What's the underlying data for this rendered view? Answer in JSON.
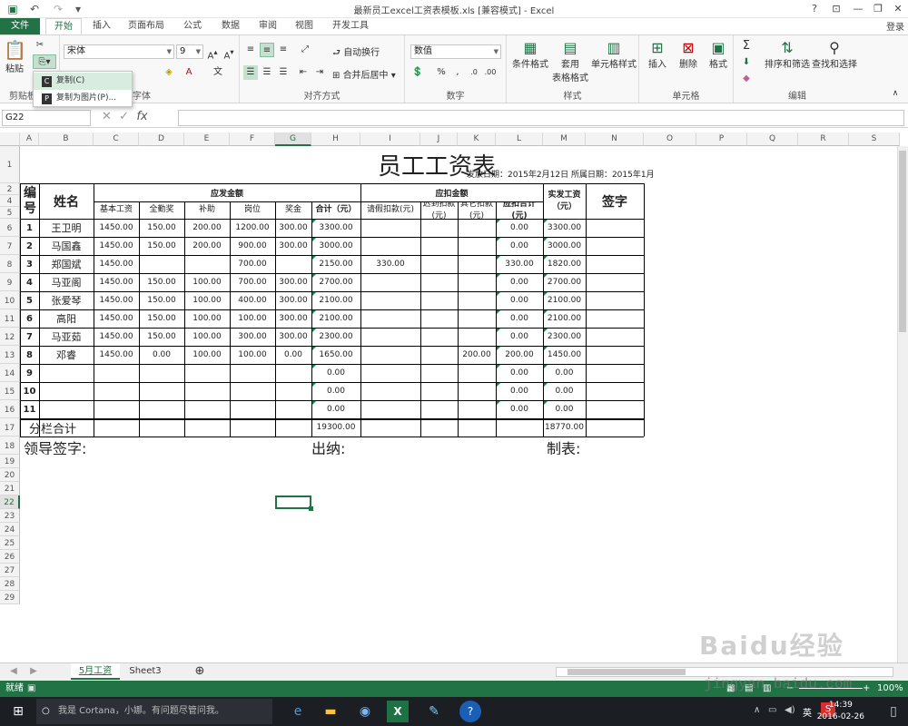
{
  "window": {
    "title": "最新员工excel工资表模板.xls  [兼容模式] - Excel",
    "login": "登录"
  },
  "tabs": [
    "文件",
    "开始",
    "插入",
    "页面布局",
    "公式",
    "数据",
    "审阅",
    "视图",
    "开发工具"
  ],
  "ribbon": {
    "clipboard": {
      "paste": "粘贴",
      "group": "剪贴板"
    },
    "font": {
      "name": "宋体",
      "size": "9",
      "group": "字体"
    },
    "alignment": {
      "wrap": "自动换行",
      "merge": "合并后居中",
      "group": "对齐方式"
    },
    "number": {
      "format": "数值",
      "percent": "%",
      "group": "数字"
    },
    "styles": {
      "cond": "条件格式",
      "table_l1": "套用",
      "table_l2": "表格格式",
      "cell": "单元格样式",
      "group": "样式"
    },
    "cells": {
      "insert": "插入",
      "delete": "删除",
      "format": "格式",
      "group": "单元格"
    },
    "editing": {
      "sort": "排序和筛选",
      "find": "查找和选择",
      "group": "编辑"
    }
  },
  "clip_menu": [
    {
      "key": "C",
      "label": "复制(C)"
    },
    {
      "key": "P",
      "label": "复制为图片(P)..."
    }
  ],
  "namebox": "G22",
  "columns": [
    "A",
    "B",
    "C",
    "D",
    "E",
    "F",
    "G",
    "H",
    "I",
    "J",
    "K",
    "L",
    "M",
    "N",
    "O",
    "P",
    "Q",
    "R",
    "S"
  ],
  "rows": [
    "1",
    "2",
    "4",
    "5",
    "6",
    "7",
    "8",
    "9",
    "10",
    "11",
    "12",
    "13",
    "14",
    "15",
    "16",
    "17",
    "18",
    "19",
    "20",
    "21",
    "22",
    "23",
    "24",
    "25",
    "26",
    "27",
    "28",
    "29"
  ],
  "sheet": {
    "title": "员工工资表",
    "subtitle": "发放日期：2015年2月12日 所属日期：2015年1月",
    "h_no": "编号",
    "h_name": "姓名",
    "h_payable": "应发金额",
    "h_deduct": "应扣金额",
    "h_actual": "实发工资（元）",
    "h_sign": "签字",
    "sub_headers": [
      "基本工资",
      "全勤奖",
      "补助",
      "岗位",
      "奖金",
      "合计（元）",
      "请假扣款(元)",
      "迟到扣款(元)",
      "其它扣款(元)",
      "应扣合计(元)"
    ],
    "data_rows": [
      [
        "1",
        "王卫明",
        "1450.00",
        "150.00",
        "200.00",
        "1200.00",
        "300.00",
        "3300.00",
        "",
        "",
        "",
        "0.00",
        "3300.00"
      ],
      [
        "2",
        "马国鑫",
        "1450.00",
        "150.00",
        "200.00",
        "900.00",
        "300.00",
        "3000.00",
        "",
        "",
        "",
        "0.00",
        "3000.00"
      ],
      [
        "3",
        "郑国斌",
        "1450.00",
        "",
        "",
        "700.00",
        "",
        "2150.00",
        "330.00",
        "",
        "",
        "330.00",
        "1820.00"
      ],
      [
        "4",
        "马亚阁",
        "1450.00",
        "150.00",
        "100.00",
        "700.00",
        "300.00",
        "2700.00",
        "",
        "",
        "",
        "0.00",
        "2700.00"
      ],
      [
        "5",
        "张爱琴",
        "1450.00",
        "150.00",
        "100.00",
        "400.00",
        "300.00",
        "2100.00",
        "",
        "",
        "",
        "0.00",
        "2100.00"
      ],
      [
        "6",
        "高阳",
        "1450.00",
        "150.00",
        "100.00",
        "100.00",
        "300.00",
        "2100.00",
        "",
        "",
        "",
        "0.00",
        "2100.00"
      ],
      [
        "7",
        "马亚茹",
        "1450.00",
        "150.00",
        "100.00",
        "300.00",
        "300.00",
        "2300.00",
        "",
        "",
        "",
        "0.00",
        "2300.00"
      ],
      [
        "8",
        "邓睿",
        "1450.00",
        "0.00",
        "100.00",
        "100.00",
        "0.00",
        "1650.00",
        "",
        "",
        "200.00",
        "200.00",
        "1450.00"
      ],
      [
        "9",
        "",
        "",
        "",
        "",
        "",
        "",
        "0.00",
        "",
        "",
        "",
        "0.00",
        "0.00"
      ],
      [
        "10",
        "",
        "",
        "",
        "",
        "",
        "",
        "0.00",
        "",
        "",
        "",
        "0.00",
        "0.00"
      ],
      [
        "11",
        "",
        "",
        "",
        "",
        "",
        "",
        "0.00",
        "",
        "",
        "",
        "0.00",
        "0.00"
      ]
    ],
    "total_label": "分栏合计",
    "total_payable": "19300.00",
    "total_actual": "18770.00",
    "sign_leader": "领导签字:",
    "sign_cashier": "出纳:",
    "sign_maker": "制表:"
  },
  "sheet_tabs": [
    "5月工资",
    "Sheet3"
  ],
  "status": {
    "ready": "就绪",
    "zoom": "100%"
  },
  "taskbar": {
    "cortana": "我是 Cortana，小娜。有问题尽管问我。",
    "time": "14:39",
    "date": "2016-02-26",
    "lang": "英"
  },
  "watermark": {
    "text": "Baidu经验",
    "url": "jingyan.baidu.com"
  }
}
